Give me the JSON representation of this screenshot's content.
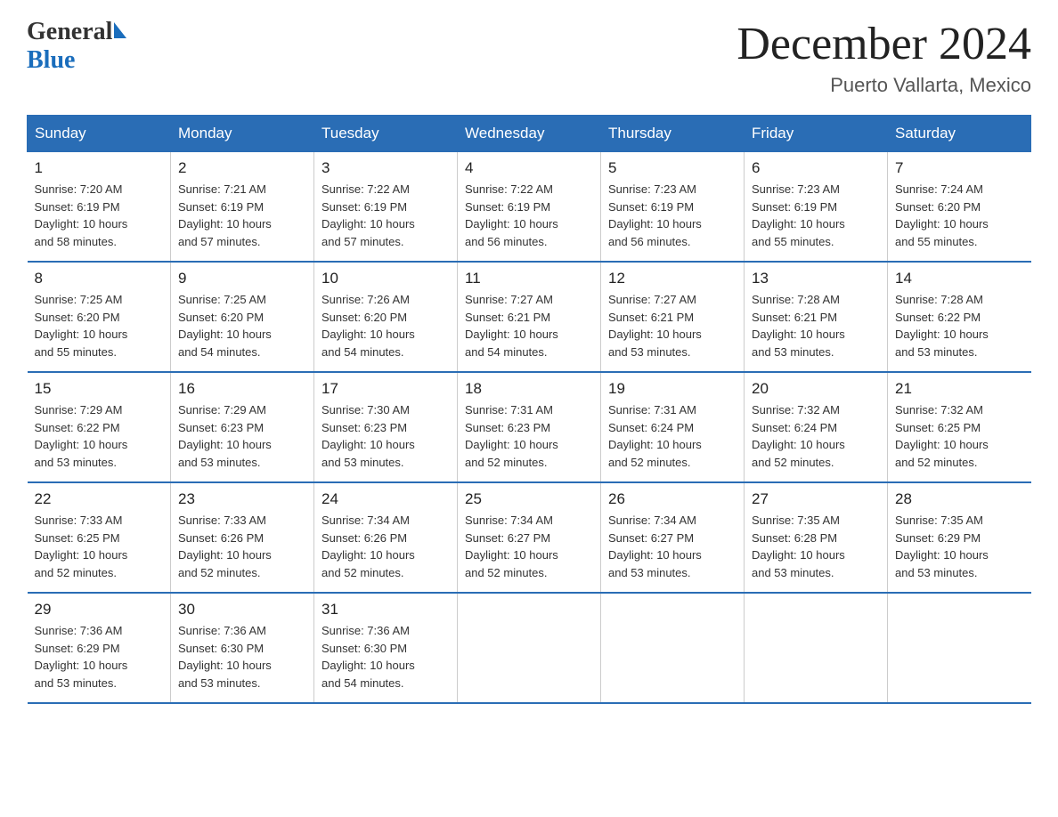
{
  "logo": {
    "general": "General",
    "blue": "Blue"
  },
  "title": "December 2024",
  "location": "Puerto Vallarta, Mexico",
  "days_of_week": [
    "Sunday",
    "Monday",
    "Tuesday",
    "Wednesday",
    "Thursday",
    "Friday",
    "Saturday"
  ],
  "weeks": [
    [
      {
        "day": "1",
        "sunrise": "7:20 AM",
        "sunset": "6:19 PM",
        "daylight": "10 hours and 58 minutes."
      },
      {
        "day": "2",
        "sunrise": "7:21 AM",
        "sunset": "6:19 PM",
        "daylight": "10 hours and 57 minutes."
      },
      {
        "day": "3",
        "sunrise": "7:22 AM",
        "sunset": "6:19 PM",
        "daylight": "10 hours and 57 minutes."
      },
      {
        "day": "4",
        "sunrise": "7:22 AM",
        "sunset": "6:19 PM",
        "daylight": "10 hours and 56 minutes."
      },
      {
        "day": "5",
        "sunrise": "7:23 AM",
        "sunset": "6:19 PM",
        "daylight": "10 hours and 56 minutes."
      },
      {
        "day": "6",
        "sunrise": "7:23 AM",
        "sunset": "6:19 PM",
        "daylight": "10 hours and 55 minutes."
      },
      {
        "day": "7",
        "sunrise": "7:24 AM",
        "sunset": "6:20 PM",
        "daylight": "10 hours and 55 minutes."
      }
    ],
    [
      {
        "day": "8",
        "sunrise": "7:25 AM",
        "sunset": "6:20 PM",
        "daylight": "10 hours and 55 minutes."
      },
      {
        "day": "9",
        "sunrise": "7:25 AM",
        "sunset": "6:20 PM",
        "daylight": "10 hours and 54 minutes."
      },
      {
        "day": "10",
        "sunrise": "7:26 AM",
        "sunset": "6:20 PM",
        "daylight": "10 hours and 54 minutes."
      },
      {
        "day": "11",
        "sunrise": "7:27 AM",
        "sunset": "6:21 PM",
        "daylight": "10 hours and 54 minutes."
      },
      {
        "day": "12",
        "sunrise": "7:27 AM",
        "sunset": "6:21 PM",
        "daylight": "10 hours and 53 minutes."
      },
      {
        "day": "13",
        "sunrise": "7:28 AM",
        "sunset": "6:21 PM",
        "daylight": "10 hours and 53 minutes."
      },
      {
        "day": "14",
        "sunrise": "7:28 AM",
        "sunset": "6:22 PM",
        "daylight": "10 hours and 53 minutes."
      }
    ],
    [
      {
        "day": "15",
        "sunrise": "7:29 AM",
        "sunset": "6:22 PM",
        "daylight": "10 hours and 53 minutes."
      },
      {
        "day": "16",
        "sunrise": "7:29 AM",
        "sunset": "6:23 PM",
        "daylight": "10 hours and 53 minutes."
      },
      {
        "day": "17",
        "sunrise": "7:30 AM",
        "sunset": "6:23 PM",
        "daylight": "10 hours and 53 minutes."
      },
      {
        "day": "18",
        "sunrise": "7:31 AM",
        "sunset": "6:23 PM",
        "daylight": "10 hours and 52 minutes."
      },
      {
        "day": "19",
        "sunrise": "7:31 AM",
        "sunset": "6:24 PM",
        "daylight": "10 hours and 52 minutes."
      },
      {
        "day": "20",
        "sunrise": "7:32 AM",
        "sunset": "6:24 PM",
        "daylight": "10 hours and 52 minutes."
      },
      {
        "day": "21",
        "sunrise": "7:32 AM",
        "sunset": "6:25 PM",
        "daylight": "10 hours and 52 minutes."
      }
    ],
    [
      {
        "day": "22",
        "sunrise": "7:33 AM",
        "sunset": "6:25 PM",
        "daylight": "10 hours and 52 minutes."
      },
      {
        "day": "23",
        "sunrise": "7:33 AM",
        "sunset": "6:26 PM",
        "daylight": "10 hours and 52 minutes."
      },
      {
        "day": "24",
        "sunrise": "7:34 AM",
        "sunset": "6:26 PM",
        "daylight": "10 hours and 52 minutes."
      },
      {
        "day": "25",
        "sunrise": "7:34 AM",
        "sunset": "6:27 PM",
        "daylight": "10 hours and 52 minutes."
      },
      {
        "day": "26",
        "sunrise": "7:34 AM",
        "sunset": "6:27 PM",
        "daylight": "10 hours and 53 minutes."
      },
      {
        "day": "27",
        "sunrise": "7:35 AM",
        "sunset": "6:28 PM",
        "daylight": "10 hours and 53 minutes."
      },
      {
        "day": "28",
        "sunrise": "7:35 AM",
        "sunset": "6:29 PM",
        "daylight": "10 hours and 53 minutes."
      }
    ],
    [
      {
        "day": "29",
        "sunrise": "7:36 AM",
        "sunset": "6:29 PM",
        "daylight": "10 hours and 53 minutes."
      },
      {
        "day": "30",
        "sunrise": "7:36 AM",
        "sunset": "6:30 PM",
        "daylight": "10 hours and 53 minutes."
      },
      {
        "day": "31",
        "sunrise": "7:36 AM",
        "sunset": "6:30 PM",
        "daylight": "10 hours and 54 minutes."
      },
      null,
      null,
      null,
      null
    ]
  ],
  "labels": {
    "sunrise": "Sunrise:",
    "sunset": "Sunset:",
    "daylight": "Daylight:"
  }
}
